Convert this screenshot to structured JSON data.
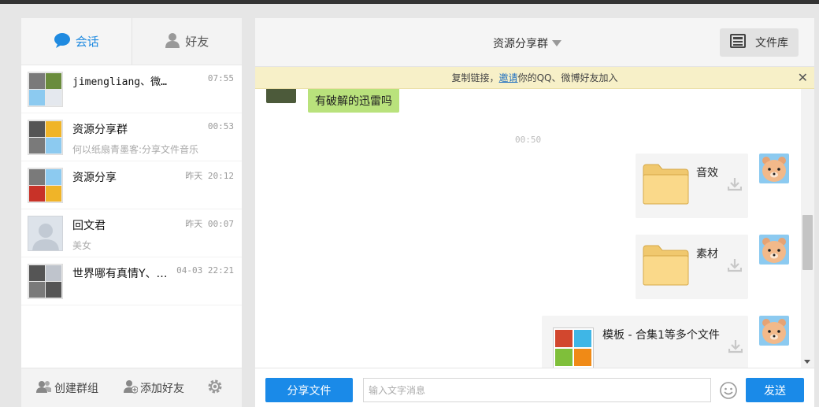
{
  "sidebar": {
    "tabs": [
      {
        "label": "会话",
        "active": true
      },
      {
        "label": "好友",
        "active": false
      }
    ],
    "conversations": [
      {
        "name": "jimengliang、微…",
        "preview": "",
        "time": "07:55"
      },
      {
        "name": "资源分享群",
        "preview": "何以纸扇青墨客:分享文件音乐",
        "time": "00:53"
      },
      {
        "name": "资源分享",
        "preview": "",
        "time": "昨天 20:12"
      },
      {
        "name": "回文君",
        "preview": "美女",
        "time": "昨天 00:07"
      },
      {
        "name": "世界哪有真情Y、…",
        "preview": "",
        "time": "04-03 22:21"
      }
    ],
    "footer": {
      "create_group": "创建群组",
      "add_friend": "添加好友"
    }
  },
  "chat": {
    "title": "资源分享群",
    "file_library": "文件库",
    "notice": {
      "prefix": "复制链接，",
      "link": "邀请",
      "suffix": "你的QQ、微博好友加入"
    },
    "messages": {
      "incoming_text": "有破解的迅雷吗",
      "time_separator": "00:50",
      "files": [
        {
          "name": "音效"
        },
        {
          "name": "素材"
        },
        {
          "name": "模板 - 合集1等多个文件"
        }
      ]
    },
    "footer": {
      "share_button": "分享文件",
      "input_placeholder": "输入文字消息",
      "send_button": "发送"
    }
  },
  "colors": {
    "accent": "#1a8ae8",
    "bubble": "#b9e27c",
    "notice_bg": "#f7f0c8"
  }
}
